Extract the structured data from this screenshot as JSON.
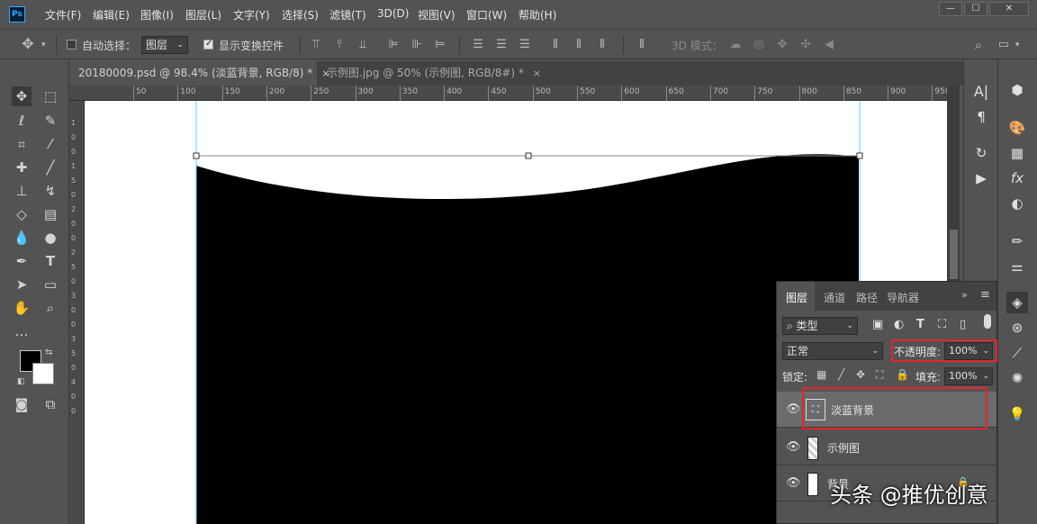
{
  "app": {
    "logo": "Ps"
  },
  "menu": [
    "文件(F)",
    "编辑(E)",
    "图像(I)",
    "图层(L)",
    "文字(Y)",
    "选择(S)",
    "滤镜(T)",
    "3D(D)",
    "视图(V)",
    "窗口(W)",
    "帮助(H)"
  ],
  "options": {
    "auto_select_label": "自动选择：",
    "auto_select_value": "图层",
    "show_transform_label": "显示变换控件",
    "mode_3d_label": "3D 模式："
  },
  "tabs": [
    {
      "label": "20180009.psd @ 98.4% (淡蓝背景, RGB/8) *",
      "close": "×"
    },
    {
      "label": "示例图.jpg @ 50% (示例图, RGB/8#) *",
      "close": "×"
    }
  ],
  "ruler": {
    "h_ticks": [
      "50",
      "100",
      "150",
      "200",
      "250",
      "300",
      "350",
      "400",
      "450",
      "500",
      "550",
      "600",
      "650",
      "700",
      "750",
      "800",
      "850",
      "900",
      "950"
    ],
    "v_ticks": [
      "1",
      "0",
      "0",
      "1",
      "5",
      "0",
      "2",
      "0",
      "0",
      "2",
      "5",
      "0",
      "3",
      "0",
      "0",
      "3",
      "5",
      "0",
      "4",
      "0",
      "0"
    ]
  },
  "layers_panel": {
    "tabs": [
      "图层",
      "通道",
      "路径",
      "导航器"
    ],
    "filter_label": "类型",
    "blend_mode": "正常",
    "opacity_label": "不透明度:",
    "opacity_value": "100%",
    "lock_label": "锁定:",
    "fill_label": "填充:",
    "fill_value": "100%",
    "layers": [
      {
        "name": "淡蓝背景",
        "selected": true
      },
      {
        "name": "示例图",
        "selected": false
      },
      {
        "name": "背景",
        "selected": false
      }
    ]
  },
  "watermark": "头条 @推优创意",
  "colors": {
    "highlight": "#e5252b",
    "guide": "#5ad7f0"
  }
}
